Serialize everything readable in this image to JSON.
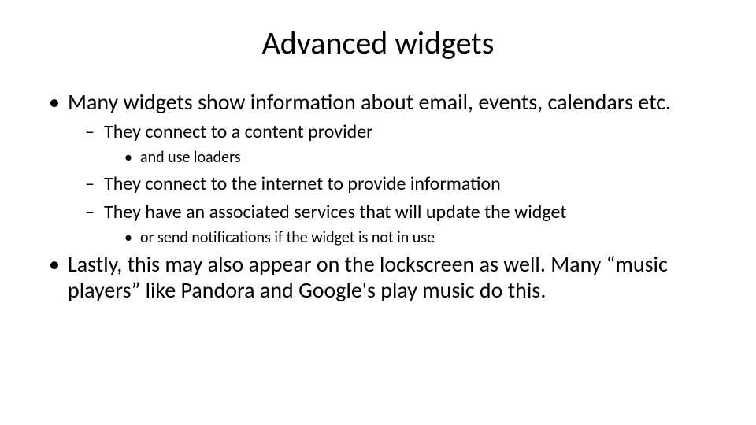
{
  "title": "Advanced widgets",
  "bullets": {
    "item1": "Many widgets show information about email, events, calendars etc.",
    "item1_sub1": "They connect to a content provider",
    "item1_sub1_sub1": "and use loaders",
    "item1_sub2": "They connect to the internet to provide information",
    "item1_sub3": "They have an associated services that will update the widget",
    "item1_sub3_sub1": "or send notifications if the widget is not in use",
    "item2": "Lastly, this may also appear on the lockscreen as well.   Many “music players” like Pandora and Google's play music do this."
  }
}
